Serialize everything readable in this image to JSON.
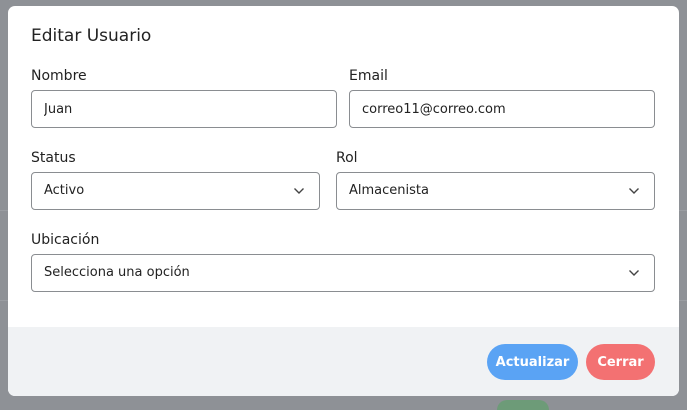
{
  "modal": {
    "title": "Editar Usuario",
    "fields": {
      "nombre": {
        "label": "Nombre",
        "value": "Juan"
      },
      "email": {
        "label": "Email",
        "value": "correo11@correo.com"
      },
      "status": {
        "label": "Status",
        "selected": "Activo"
      },
      "rol": {
        "label": "Rol",
        "selected": "Almacenista"
      },
      "ubicacion": {
        "label": "Ubicación",
        "selected": "Selecciona una opción"
      }
    },
    "buttons": {
      "update": "Actualizar",
      "close": "Cerrar"
    }
  },
  "colors": {
    "update_button": "#5aa3f4",
    "close_button": "#f37172",
    "footer_bg": "#f0f2f4",
    "overlay": "#8f9297"
  },
  "icons": {
    "select_arrow": "chevron-down-icon"
  }
}
